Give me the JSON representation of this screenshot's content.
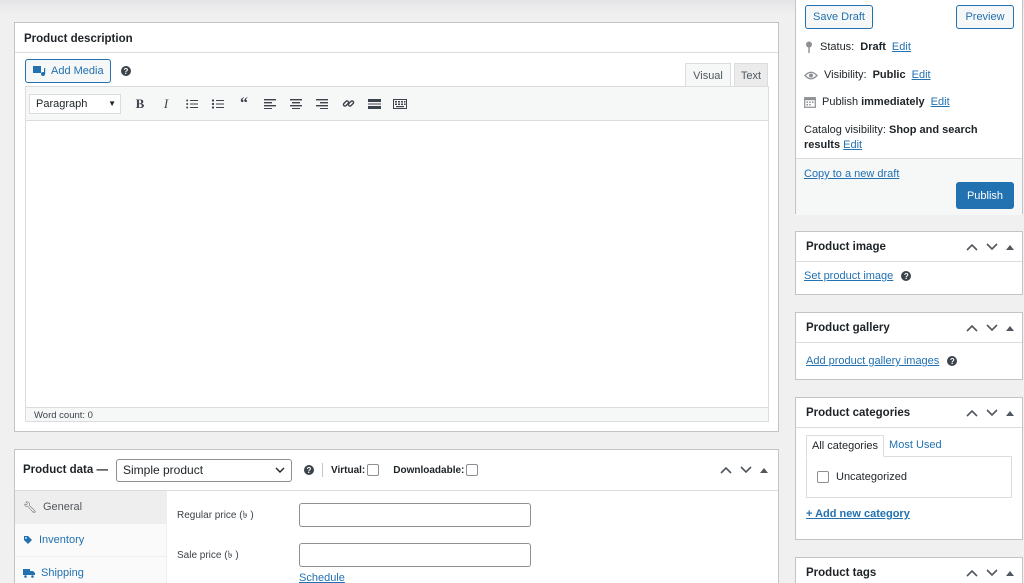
{
  "description": {
    "title": "Product description",
    "add_media": "Add Media",
    "tab_visual": "Visual",
    "tab_text": "Text",
    "format_select": "Paragraph",
    "word_count": "Word count: 0"
  },
  "product_data": {
    "title": "Product data —",
    "type_select": "Simple product",
    "virtual_label": "Virtual:",
    "downloadable_label": "Downloadable:",
    "tabs": [
      {
        "label": "General",
        "icon": "wrench-icon"
      },
      {
        "label": "Inventory",
        "icon": "tag-icon"
      },
      {
        "label": "Shipping",
        "icon": "truck-icon"
      }
    ],
    "regular_price_label": "Regular price (৳ )",
    "sale_price_label": "Sale price (৳ )",
    "schedule_link": "Schedule"
  },
  "publish": {
    "save_draft": "Save Draft",
    "preview": "Preview",
    "status_label": "Status:",
    "status_value": "Draft",
    "visibility_label": "Visibility:",
    "visibility_value": "Public",
    "publish_label": "Publish",
    "publish_value": "immediately",
    "edit": "Edit",
    "catalog_label": "Catalog visibility:",
    "catalog_value_1": "Shop and search",
    "catalog_value_2": "results",
    "copy_draft": "Copy to a new draft",
    "publish_button": "Publish"
  },
  "product_image": {
    "title": "Product image",
    "link": "Set product image"
  },
  "product_gallery": {
    "title": "Product gallery",
    "link": "Add product gallery images"
  },
  "categories": {
    "title": "Product categories",
    "tab_all": "All categories",
    "tab_most": "Most Used",
    "item": "Uncategorized",
    "add_new": "+ Add new category"
  },
  "tags": {
    "title": "Product tags"
  },
  "colors": {
    "accent": "#2271b1",
    "border": "#c3c4c7",
    "background": "#f0f0f1"
  }
}
